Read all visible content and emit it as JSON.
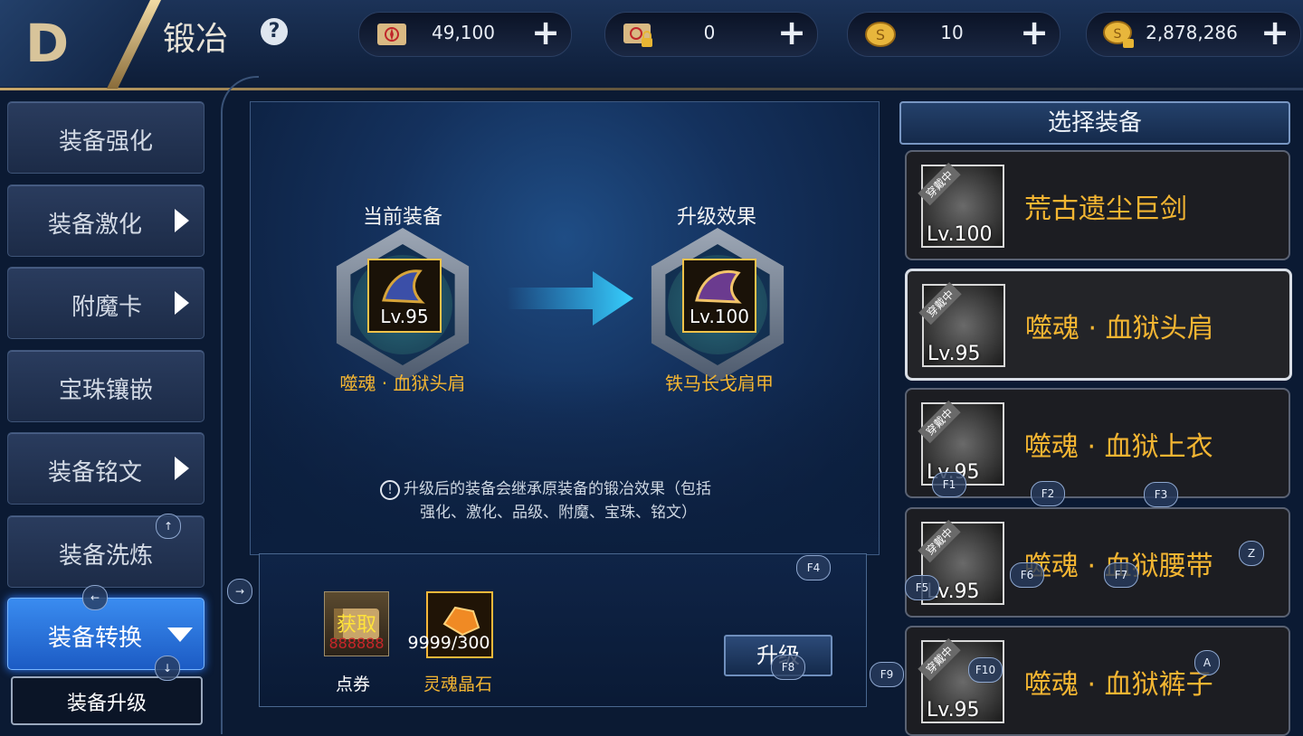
{
  "header": {
    "title": "锻冶",
    "help_icon": "question-icon",
    "back_icon": "back-icon"
  },
  "currencies": [
    {
      "name": "scroll",
      "icon": "red-seal-scroll-icon",
      "value": "49,100",
      "add": "+"
    },
    {
      "name": "locked-scroll",
      "icon": "locked-scroll-icon",
      "value": "0",
      "add": "+"
    },
    {
      "name": "coin",
      "icon": "gold-coin-icon",
      "value": "10",
      "add": "+"
    },
    {
      "name": "locked-coin",
      "icon": "locked-gold-coin-icon",
      "value": "2,878,286",
      "add": "+"
    }
  ],
  "sidebar": {
    "items": [
      {
        "label": "装备强化",
        "chevron": false
      },
      {
        "label": "装备激化",
        "chevron": true
      },
      {
        "label": "附魔卡",
        "chevron": true
      },
      {
        "label": "宝珠镶嵌",
        "chevron": false
      },
      {
        "label": "装备铭文",
        "chevron": true
      },
      {
        "label": "装备洗炼",
        "chevron": false
      },
      {
        "label": "装备转换",
        "chevron": true,
        "active": true
      }
    ],
    "subitem": {
      "label": "装备升级"
    }
  },
  "center": {
    "current_label": "当前装备",
    "result_label": "升级效果",
    "current_item": {
      "lv": "Lv.95",
      "name": "噬魂 · 血狱头肩"
    },
    "result_item": {
      "lv": "Lv.100",
      "name": "铁马长戈肩甲"
    },
    "note_line1": "升级后的装备会继承原装备的锻冶效果（包括",
    "note_line2": "强化、激化、品级、附魔、宝珠、铭文）"
  },
  "cost": {
    "ticket": {
      "overlay": "获取",
      "count": "888888",
      "label": "点券"
    },
    "crystal": {
      "count": "9999/300",
      "label": "灵魂晶石"
    },
    "upgrade_button": "升级"
  },
  "right_panel": {
    "title": "选择装备",
    "equipped_tag": "穿戴中",
    "items": [
      {
        "name": "荒古遗尘巨剑",
        "lv": "Lv.100",
        "selected": false
      },
      {
        "name": "噬魂 · 血狱头肩",
        "lv": "Lv.95",
        "selected": true
      },
      {
        "name": "噬魂 · 血狱上衣",
        "lv": "Lv.95",
        "selected": false
      },
      {
        "name": "噬魂 · 血狱腰带",
        "lv": "Lv.95",
        "selected": false
      },
      {
        "name": "噬魂 · 血狱裤子",
        "lv": "Lv.95",
        "selected": false
      }
    ]
  },
  "key_hints": {
    "up": "↑",
    "left": "←",
    "right": "→",
    "down": "↓",
    "f1": "F1",
    "f2": "F2",
    "f3": "F3",
    "f4": "F4",
    "f5": "F5",
    "f6": "F6",
    "f7": "F7",
    "f8": "F8",
    "f9": "F9",
    "f10": "F10",
    "z": "Z",
    "a": "A"
  },
  "colors": {
    "accent_gold": "#f3b532",
    "active_blue": "#2f7cff"
  }
}
